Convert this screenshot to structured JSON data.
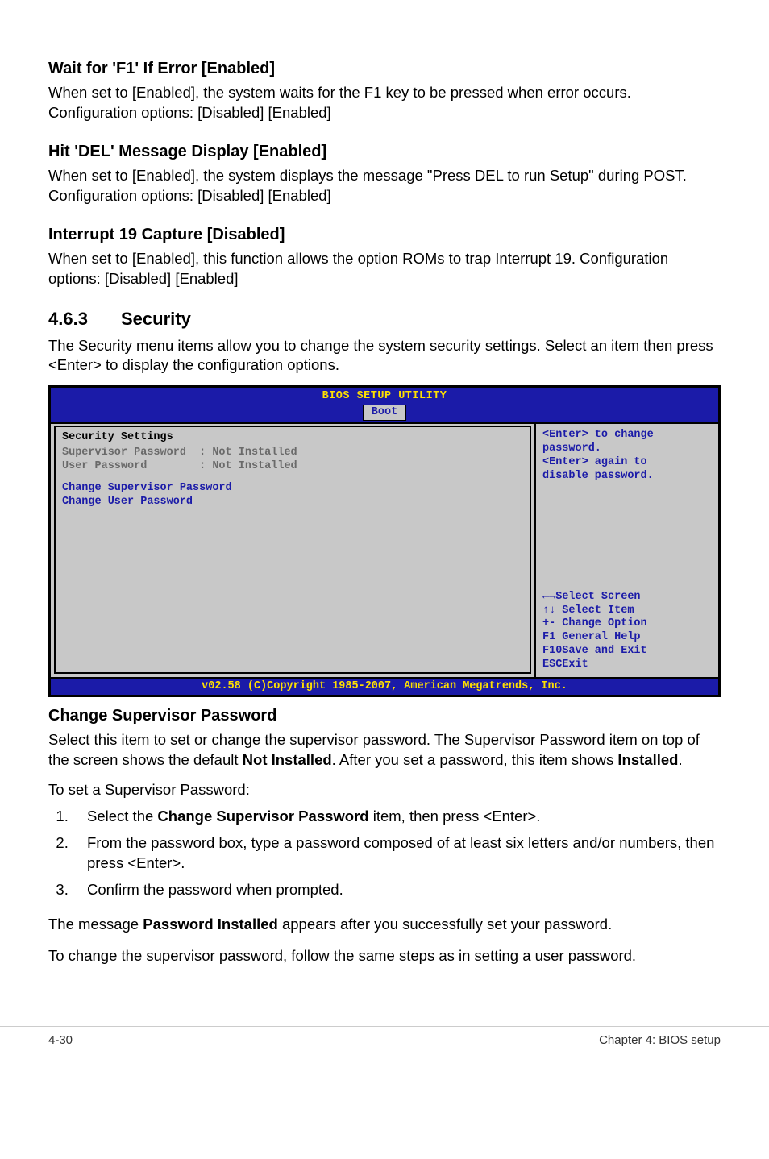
{
  "sec1": {
    "title": "Wait for 'F1' If Error [Enabled]",
    "body": "When set to [Enabled], the system waits for the F1 key to be pressed when error occurs. Configuration options: [Disabled] [Enabled]"
  },
  "sec2": {
    "title": "Hit 'DEL' Message Display [Enabled]",
    "body": "When set to [Enabled], the system displays the message \"Press DEL to run Setup\" during POST. Configuration options: [Disabled] [Enabled]"
  },
  "sec3": {
    "title": "Interrupt 19 Capture [Disabled]",
    "body": "When set to [Enabled], this function allows the option ROMs to trap Interrupt 19. Configuration options: [Disabled] [Enabled]"
  },
  "sec4": {
    "number": "4.6.3",
    "title": "Security",
    "body": "The Security menu items allow you to change the system security settings. Select an item then press <Enter> to display the configuration options."
  },
  "bios": {
    "title": "BIOS SETUP UTILITY",
    "tab": "Boot",
    "section_title": "Security Settings",
    "line1": "Supervisor Password  : Not Installed",
    "line2": "User Password        : Not Installed",
    "line3": "Change Supervisor Password",
    "line4": "Change User Password",
    "help1": "<Enter> to change",
    "help2": "password.",
    "help3": "<Enter> again to",
    "help4": "disable password.",
    "nav1": "←→Select Screen",
    "nav2": "↑↓ Select Item",
    "nav3": "+- Change Option",
    "nav4": "F1 General Help",
    "nav5": "F10Save and Exit",
    "nav6": "ESCExit",
    "footer": "v02.58 (C)Copyright 1985-2007, American Megatrends, Inc."
  },
  "sec5": {
    "title": "Change Supervisor Password",
    "body_pre": "Select this item to set or change the supervisor password. The Supervisor Password item on top of the screen shows the default ",
    "body_bold1": "Not Installed",
    "body_mid": ". After you set a password, this item shows ",
    "body_bold2": "Installed",
    "body_post": ".",
    "toset": "To set a Supervisor Password:",
    "s1_pre": "Select the ",
    "s1_bold": "Change Supervisor Password",
    "s1_post": " item, then press <Enter>.",
    "s2": "From the password box, type a password composed of at least six letters and/or numbers, then press <Enter>.",
    "s3": "Confirm the password when prompted.",
    "msg_pre": "The message ",
    "msg_bold": "Password Installed",
    "msg_post": " appears after you successfully set your password.",
    "tochange": "To change the supervisor password, follow the same steps as in setting a user password."
  },
  "footer": {
    "left": "4-30",
    "right": "Chapter 4: BIOS setup"
  }
}
